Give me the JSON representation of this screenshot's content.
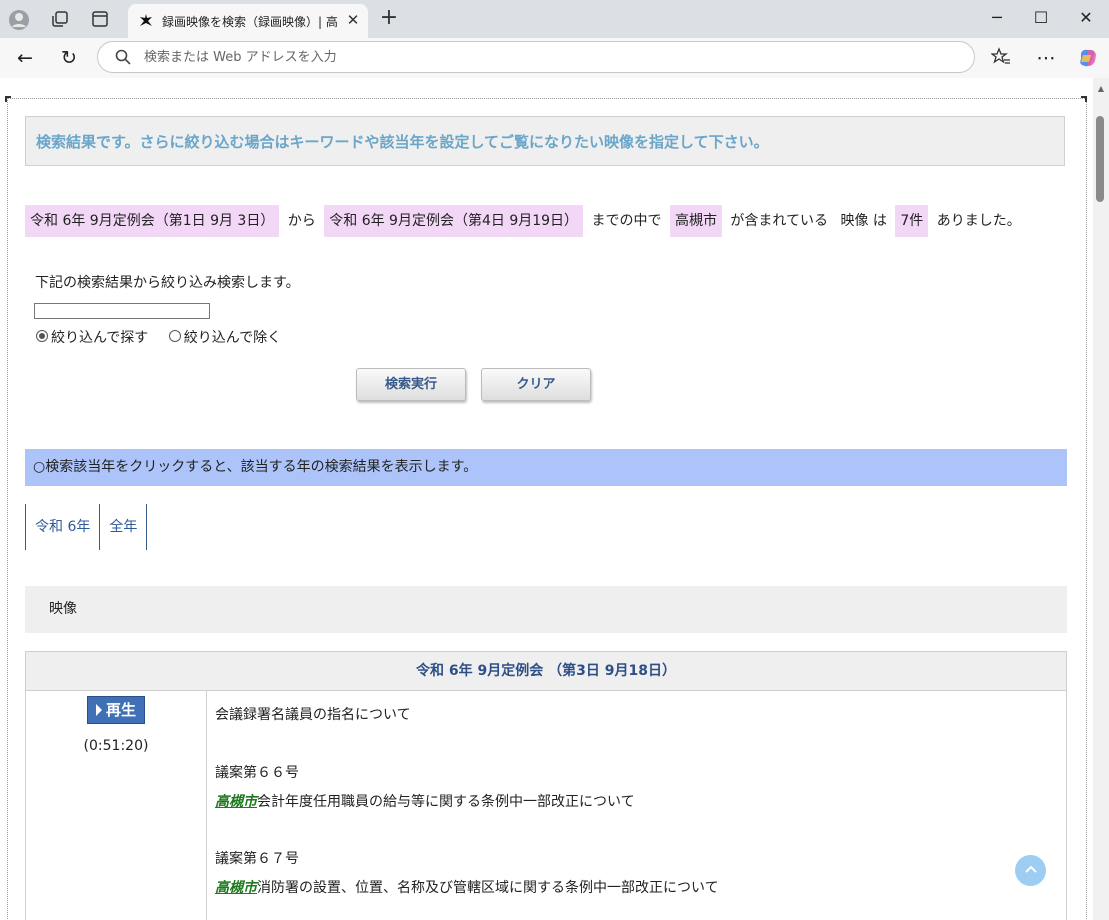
{
  "browser": {
    "tab_title": "録画映像を検索（録画映像）| 高槻",
    "address_placeholder": "検索または Web アドレスを入力",
    "new_tab_label": "+",
    "close_tab_label": "✕"
  },
  "page": {
    "notice": "検索結果です。さらに絞り込む場合はキーワードや該当年を設定してご覧になりたい映像を指定して下さい。",
    "summary": {
      "from_session": "令和 6年 9月定例会（第1日 9月 3日）",
      "from_text": "から",
      "to_session": "令和 6年 9月定例会（第4日 9月19日）",
      "to_text": "までの中で",
      "keyword": "高槻市",
      "contained_text": "が含まれている",
      "type_text": "映像 は",
      "count": "7件",
      "end_text": "ありました。"
    },
    "refine": {
      "label": "下記の検索結果から絞り込み検索します。",
      "input_value": "",
      "radio_include": "絞り込んで探す",
      "radio_exclude": "絞り込んで除く",
      "search_button": "検索実行",
      "clear_button": "クリア"
    },
    "year_note": "○検索該当年をクリックすると、該当する年の検索結果を表示します。",
    "year_links": [
      "令和 6年",
      "全年"
    ],
    "video_header": "映像",
    "session": {
      "title": "令和 6年 9月定例会 （第3日 9月18日）",
      "play_label": "再生",
      "duration": "(0:51:20)",
      "agenda": {
        "item1": "会議録署名議員の指名について",
        "item2_title": "議案第６６号",
        "item2_city": "高槻市",
        "item2_rest": "会計年度任用職員の給与等に関する条例中一部改正について",
        "item3_title": "議案第６７号",
        "item3_city": "高槻市",
        "item3_rest": "消防署の設置、位置、名称及び管轄区域に関する条例中一部改正について"
      }
    }
  }
}
